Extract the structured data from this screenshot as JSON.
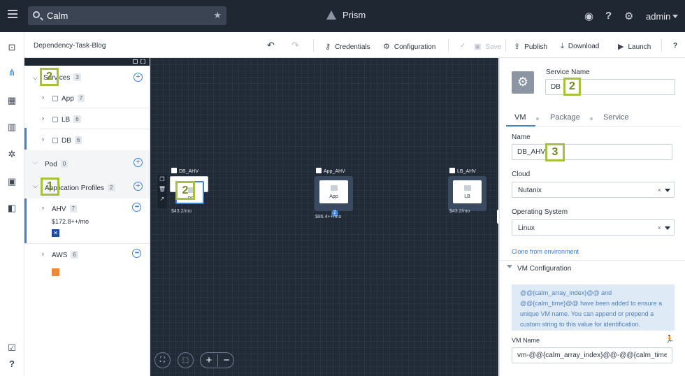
{
  "topbar": {
    "search_value": "Calm",
    "product": "Prism",
    "user": "admin"
  },
  "toolbar": {
    "blueprint_name": "Dependency-Task-Blog",
    "credentials": "Credentials",
    "configuration": "Configuration",
    "save": "Save",
    "publish": "Publish",
    "download": "Download",
    "launch": "Launch",
    "help": "?"
  },
  "tree": {
    "services_label": "Services",
    "services_count": "3",
    "services": [
      {
        "label": "App",
        "count": "7"
      },
      {
        "label": "LB",
        "count": "6"
      },
      {
        "label": "DB",
        "count": "6"
      }
    ],
    "pod_label": "Pod",
    "pod_count": "0",
    "profiles_label": "Application Profiles",
    "profiles_count": "2",
    "profiles": [
      {
        "label": "AHV",
        "count": "7",
        "cost": "$172.8++/mo"
      },
      {
        "label": "AWS",
        "count": "6"
      }
    ]
  },
  "callouts": {
    "services": "2",
    "profiles": "1",
    "canvas_node": "2",
    "service_name": "2",
    "vm_name": "3"
  },
  "canvas": {
    "nodes": [
      {
        "title": "DB_AHV",
        "label": "DB",
        "cost": "$43.2/mo"
      },
      {
        "title": "App_AHV",
        "label": "App",
        "cost": "$86.4++/mo",
        "badge": "2"
      },
      {
        "title": "LB_AHV",
        "label": "LB",
        "cost": "$43.2/mo"
      }
    ],
    "zoom_in": "+",
    "zoom_out": "−"
  },
  "inspector": {
    "service_name_label": "Service Name",
    "service_name_value": "DB",
    "tabs": [
      "VM",
      "Package",
      "Service"
    ],
    "name_label": "Name",
    "name_value": "DB_AHV",
    "cloud_label": "Cloud",
    "cloud_value": "Nutanix",
    "os_label": "Operating System",
    "os_value": "Linux",
    "clear": "×",
    "clone_link": "Clone from environment",
    "vm_config_title": "VM Configuration",
    "info_text": "@@{calm_array_index}@@ and @@{calm_time}@@ have been added to ensure a unique VM name. You can append or prepend a custom string to this value for identification.",
    "vm_name_label": "VM Name",
    "vm_name_value": "vm-@@{calm_array_index}@@-@@{calm_time}@@"
  },
  "colors": {
    "topbar": "#1f2733",
    "canvas": "#212b38",
    "accent": "#3a82d6",
    "callout": "#a6c23a"
  }
}
